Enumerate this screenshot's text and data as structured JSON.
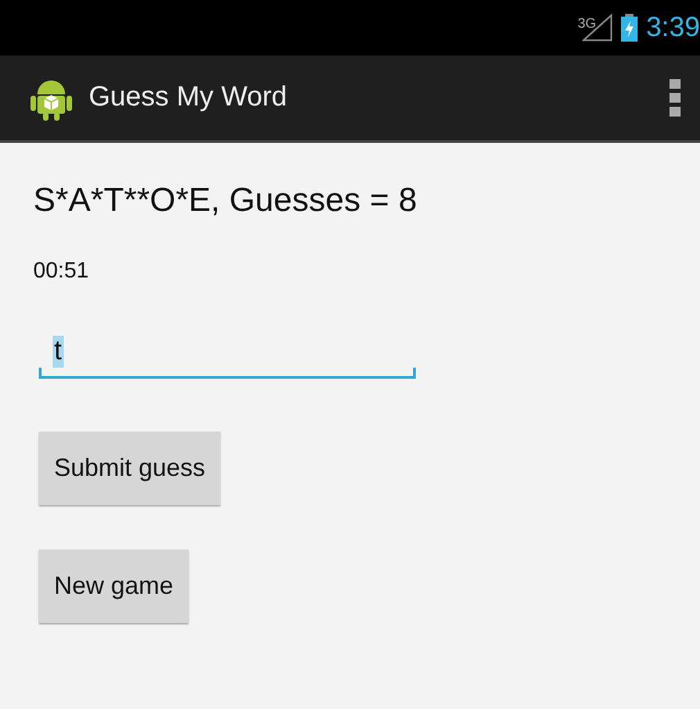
{
  "status_bar": {
    "network": "3G",
    "time": "3:39"
  },
  "action_bar": {
    "title": "Guess My Word"
  },
  "word_status": "S*A*T**O*E, Guesses = 8",
  "timer": "00:51",
  "guess_field": {
    "value": "t",
    "value_selected": true
  },
  "buttons": [
    {
      "label": "Submit guess"
    },
    {
      "label": "New game"
    }
  ]
}
